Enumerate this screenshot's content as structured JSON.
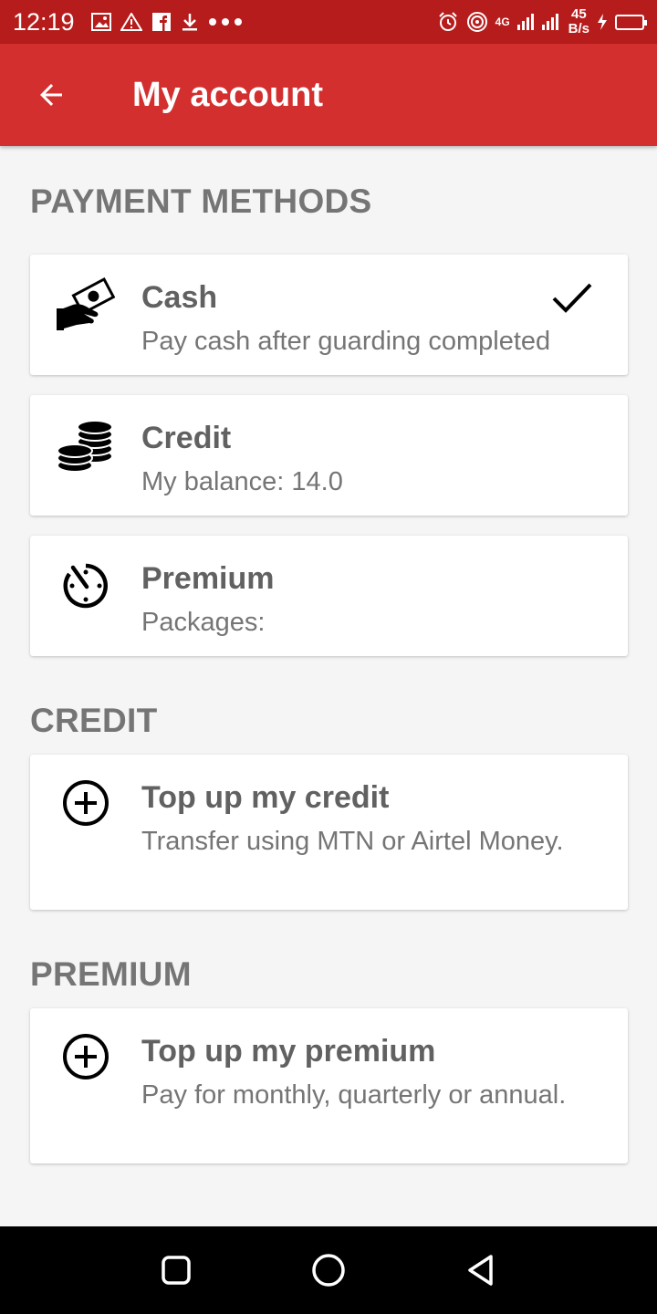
{
  "status_bar": {
    "time": "12:19",
    "network_type": "4G",
    "speed_value": "45",
    "speed_unit": "B/s"
  },
  "app_bar": {
    "title": "My account"
  },
  "sections": {
    "payment_methods": {
      "header": "PAYMENT METHODS",
      "cash": {
        "title": "Cash",
        "subtitle": "Pay cash after guarding completed",
        "selected": true,
        "icon": "cash-hand-icon"
      },
      "credit": {
        "title": "Credit",
        "subtitle": "My balance: 14.0",
        "icon": "coins-icon"
      },
      "premium": {
        "title": "Premium",
        "subtitle": "Packages:",
        "icon": "timer-icon"
      }
    },
    "credit": {
      "header": "CREDIT",
      "top_up": {
        "title": "Top up my credit",
        "subtitle": "Transfer using MTN or Airtel Money.",
        "icon": "add-circle-icon"
      }
    },
    "premium": {
      "header": "PREMIUM",
      "top_up": {
        "title": "Top up my premium",
        "subtitle": "Pay for monthly, quarterly or annual.",
        "icon": "add-circle-icon"
      }
    }
  },
  "colors": {
    "primary": "#d32f2f",
    "primary_dark": "#b71c1c",
    "background": "#f5f5f5",
    "text_secondary": "#757575"
  }
}
